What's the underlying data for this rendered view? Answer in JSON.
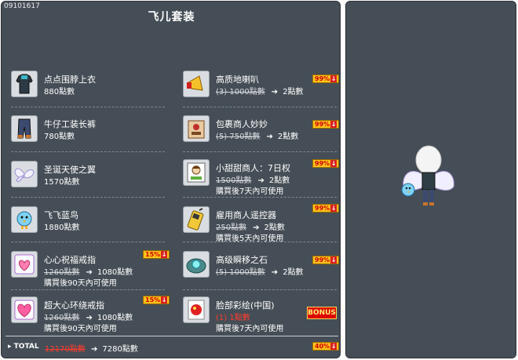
{
  "header": {
    "item_code": "09101617",
    "title": "飞儿套装"
  },
  "left_items": [
    {
      "name": "点点围脖上衣",
      "price": "880點數",
      "icon": "jacket-icon"
    },
    {
      "name": "牛仔工装长裤",
      "price": "780點數",
      "icon": "pants-icon"
    },
    {
      "name": "圣诞天使之翼",
      "price": "1570點數",
      "icon": "angel-wings-icon"
    },
    {
      "name": "飞飞蓝鸟",
      "price": "1880點數",
      "icon": "blue-bird-icon"
    },
    {
      "name": "心心祝福戒指",
      "old_price": "1260點數",
      "new_price": "1080點數",
      "note": "購買後90天內可使用",
      "discount": "15%",
      "icon": "heart-ring-icon"
    },
    {
      "name": "超大心环绕戒指",
      "old_price": "1260點數",
      "new_price": "1080點數",
      "note": "購買後90天內可使用",
      "discount": "15%",
      "icon": "big-heart-ring-icon"
    }
  ],
  "right_items": [
    {
      "name": "高质地喇叭",
      "old_price": "(3) 1000點數",
      "new_price": "2點數",
      "discount": "99%",
      "icon": "megaphone-icon"
    },
    {
      "name": "包裹商人妙妙",
      "old_price": "(5) 750點數",
      "new_price": "2點數",
      "discount": "99%",
      "icon": "parcel-merchant-icon"
    },
    {
      "name": "小甜甜商人：7日权",
      "old_price": "1500點數",
      "new_price": "2點數",
      "note": "購買後7天內可使用",
      "discount": "99%",
      "icon": "merchant-permit-icon"
    },
    {
      "name": "雇用商人遥控器",
      "old_price": "250點數",
      "new_price": "2點數",
      "note": "購買後5天內可使用",
      "discount": "99%",
      "icon": "remote-control-icon"
    },
    {
      "name": "高级瞬移之石",
      "old_price": "(5) 1000點數",
      "new_price": "2點數",
      "discount": "99%",
      "icon": "teleport-rock-icon"
    },
    {
      "name": "脸部彩绘(中国)",
      "price_red": "(1) 1點數",
      "note": "購買後7天內可使用",
      "badge": "BONUS",
      "icon": "face-paint-icon"
    }
  ],
  "total": {
    "label": "TOTAL",
    "old": "12170點數",
    "new": "7280點數",
    "discount": "40%"
  },
  "arrow": "➔",
  "colors": {
    "panel": "#454e56",
    "discount_badge": "#ffc21a",
    "red_price": "#ff3b2f"
  }
}
